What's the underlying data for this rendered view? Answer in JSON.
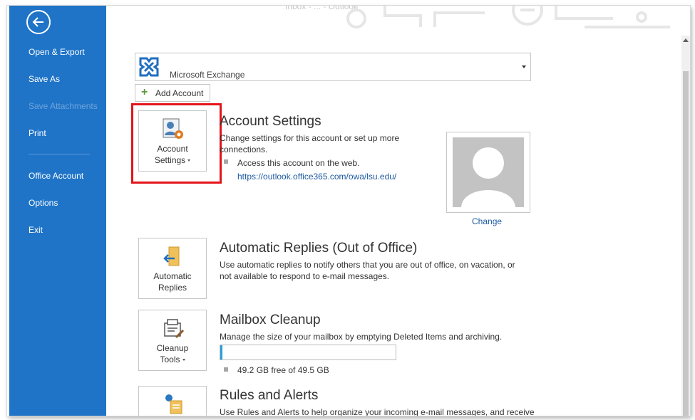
{
  "window": {
    "title": "Inbox - ... - Outlook"
  },
  "backstage": {
    "items": [
      {
        "label": "Open & Export",
        "enabled": true
      },
      {
        "label": "Save As",
        "enabled": true
      },
      {
        "label": "Save Attachments",
        "enabled": false
      },
      {
        "label": "Print",
        "enabled": true
      },
      {
        "label": "Office Account",
        "enabled": true
      },
      {
        "label": "Options",
        "enabled": true
      },
      {
        "label": "Exit",
        "enabled": true
      }
    ]
  },
  "account": {
    "selected": "Microsoft Exchange",
    "add_account_label": "Add Account"
  },
  "account_settings": {
    "tile_label_line1": "Account",
    "tile_label_line2": "Settings",
    "title": "Account Settings",
    "desc_line1": "Change settings for this account or set up more",
    "desc_line2": "connections.",
    "bullet_text": "Access this account on the web.",
    "web_link": "https://outlook.office365.com/owa/lsu.edu/",
    "change_label": "Change"
  },
  "auto_replies": {
    "tile_label_line1": "Automatic",
    "tile_label_line2": "Replies",
    "title": "Automatic Replies (Out of Office)",
    "desc_line1": "Use automatic replies to notify others that you are out of office, on vacation, or",
    "desc_line2": "not available to respond to e-mail messages."
  },
  "mailbox_cleanup": {
    "tile_label_line1": "Cleanup",
    "tile_label_line2": "Tools",
    "title": "Mailbox Cleanup",
    "desc": "Manage the size of your mailbox by emptying Deleted Items and archiving.",
    "usage_fraction": 0.004,
    "free_text": "49.2 GB free of 49.5 GB"
  },
  "rules_alerts": {
    "title": "Rules and Alerts",
    "desc": "Use Rules and Alerts to help organize your incoming e-mail messages, and receive"
  },
  "colors": {
    "backstage_blue": "#1f74c7",
    "highlight_red": "#e3151a",
    "link_blue": "#1e5aa0",
    "progress_fill": "#26a0da"
  }
}
